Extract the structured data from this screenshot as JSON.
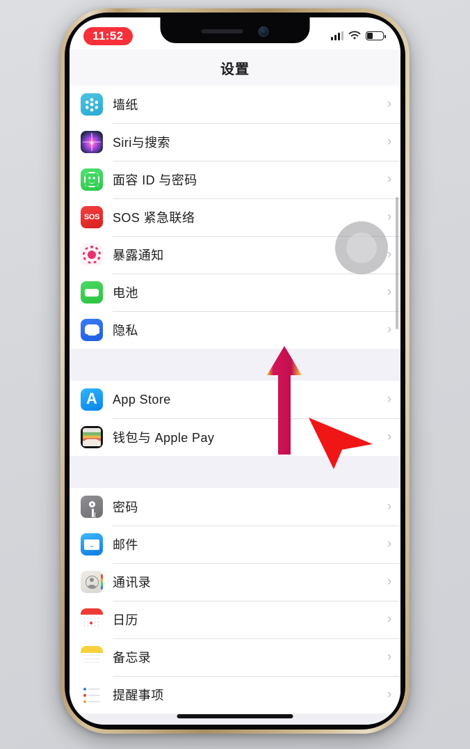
{
  "device": {
    "frame_color": "#c0a271",
    "bezel_color": "#07070a",
    "home_indicator": "home-indicator"
  },
  "status_bar": {
    "time": "11:52",
    "time_badge_color": "#f7303a",
    "cellular_icon": "cellular-signal-icon",
    "cellular_bars_filled": 3,
    "cellular_bars_total": 4,
    "wifi_icon": "wifi-icon",
    "battery_icon": "battery-icon",
    "battery_level_percent": 35
  },
  "nav": {
    "title": "设置"
  },
  "sections": [
    {
      "id": "section-system",
      "rows": [
        {
          "label": "墙纸",
          "icon": "wallpaper-icon",
          "icon_class": "ico-wallpaper",
          "chevron": "›"
        },
        {
          "label": "Siri与搜索",
          "icon": "siri-icon",
          "icon_class": "ico-siri",
          "chevron": "›"
        },
        {
          "label": "面容 ID 与密码",
          "icon": "face-id-icon",
          "icon_class": "ico-faceid",
          "chevron": "›"
        },
        {
          "label": "SOS 紧急联络",
          "icon": "sos-icon",
          "icon_class": "ico-sos",
          "chevron": "›"
        },
        {
          "label": "暴露通知",
          "icon": "exposure-notification-icon",
          "icon_class": "ico-exposure",
          "chevron": "›"
        },
        {
          "label": "电池",
          "icon": "battery-settings-icon",
          "icon_class": "ico-battery",
          "chevron": "›"
        },
        {
          "label": "隐私",
          "icon": "privacy-hand-icon",
          "icon_class": "ico-privacy",
          "chevron": "›"
        }
      ]
    },
    {
      "id": "section-store",
      "rows": [
        {
          "label": "App Store",
          "icon": "app-store-icon",
          "icon_class": "ico-appstore",
          "chevron": "›"
        },
        {
          "label": "钱包与 Apple Pay",
          "icon": "wallet-icon",
          "icon_class": "ico-wallet",
          "chevron": "›"
        }
      ]
    },
    {
      "id": "section-apps",
      "rows": [
        {
          "label": "密码",
          "icon": "passwords-key-icon",
          "icon_class": "ico-passwords",
          "chevron": "›"
        },
        {
          "label": "邮件",
          "icon": "mail-icon",
          "icon_class": "ico-mail",
          "chevron": "›"
        },
        {
          "label": "通讯录",
          "icon": "contacts-icon",
          "icon_class": "ico-contacts",
          "chevron": "›"
        },
        {
          "label": "日历",
          "icon": "calendar-icon",
          "icon_class": "ico-calendar",
          "chevron": "›"
        },
        {
          "label": "备忘录",
          "icon": "notes-icon",
          "icon_class": "ico-notes",
          "chevron": "›"
        },
        {
          "label": "提醒事项",
          "icon": "reminders-icon",
          "icon_class": "ico-reminders",
          "chevron": "›"
        }
      ]
    }
  ],
  "overlays": {
    "touch_indicator": "touch-indicator",
    "scrollbar": "vertical-scrollbar",
    "up_arrow_annotation": "up-arrow-annotation",
    "up_arrow_color": "#d4145a",
    "cursor_annotation": "red-cursor-pointer",
    "cursor_color": "#f01616"
  }
}
